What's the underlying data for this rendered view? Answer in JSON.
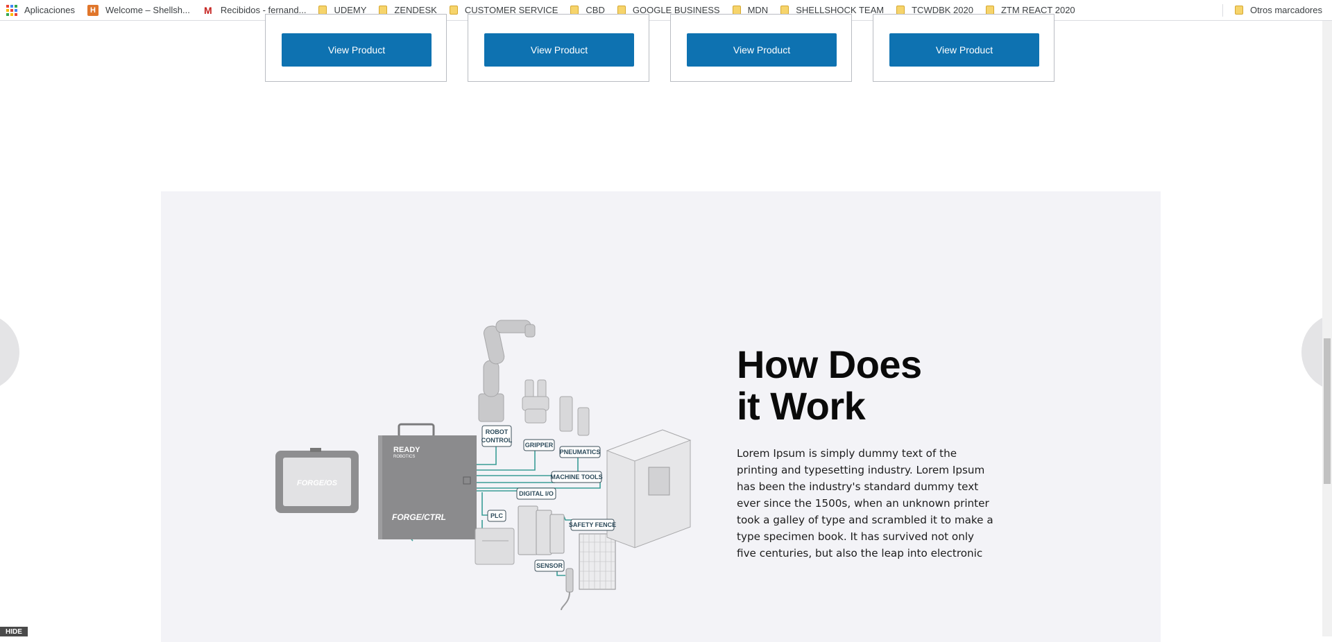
{
  "bookmarks_bar": {
    "items": [
      {
        "label": "Aplicaciones",
        "icon": "apps-grid-icon"
      },
      {
        "label": "Welcome – Shellsh...",
        "icon": "h-favicon-icon"
      },
      {
        "label": "Recibidos - fernand...",
        "icon": "gmail-icon"
      },
      {
        "label": "UDEMY",
        "icon": "folder-icon"
      },
      {
        "label": "ZENDESK",
        "icon": "folder-icon"
      },
      {
        "label": "CUSTOMER SERVICE",
        "icon": "folder-icon"
      },
      {
        "label": "CBD",
        "icon": "folder-icon"
      },
      {
        "label": "GOOGLE BUSINESS",
        "icon": "folder-icon"
      },
      {
        "label": "MDN",
        "icon": "folder-icon"
      },
      {
        "label": "SHELLSHOCK TEAM",
        "icon": "folder-icon"
      },
      {
        "label": "TCWDBK 2020",
        "icon": "folder-icon"
      },
      {
        "label": "ZTM REACT 2020",
        "icon": "folder-icon"
      }
    ],
    "other_bookmarks": "Otros marcadores"
  },
  "products": {
    "buttons": [
      "View Product",
      "View Product",
      "View Product",
      "View Product"
    ]
  },
  "how_it_works": {
    "heading_line1": "How Does",
    "heading_line2": "it Work",
    "body": "Lorem Ipsum is simply dummy text of the printing and typesetting industry. Lorem Ipsum has been the industry's standard dummy text ever since the 1500s, when an unknown printer took a galley of type and scrambled it to make a type specimen book. It has survived not only five centuries, but also the leap into electronic"
  },
  "diagram": {
    "brand_ready": "READY",
    "brand_robotics": "ROBOTICS",
    "brand_forge_ctrl": "FORGE/CTRL",
    "brand_forge_os": "FORGE/OS",
    "labels": {
      "robot_control_1": "ROBOT",
      "robot_control_2": "CONTROL",
      "gripper": "GRIPPER",
      "pneumatics": "PNEUMATICS",
      "machine_tools": "MACHINE TOOLS",
      "digital_io": "DIGITAL I/O",
      "plc": "PLC",
      "safety_fence": "SAFETY FENCE",
      "sensor": "SENSOR"
    }
  },
  "dev_badge": "HIDE",
  "colors": {
    "button_blue": "#0e72b1",
    "section_bg": "#f3f3f7",
    "connector_teal": "#3a9d96"
  }
}
